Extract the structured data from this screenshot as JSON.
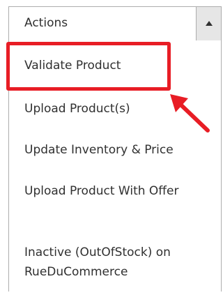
{
  "dropdown": {
    "label": "Actions",
    "toggle_icon": "caret-up-icon",
    "items": [
      {
        "label": "Validate Product"
      },
      {
        "label": "Upload Product(s)"
      },
      {
        "label": "Update Inventory & Price"
      },
      {
        "label": "Upload Product With Offer"
      },
      {
        "label": "Inactive (OutOfStock) on RueDuCommerce"
      }
    ]
  },
  "annotation": {
    "highlight_color": "#e81d25",
    "arrow_icon": "arrow-pointer-icon"
  }
}
